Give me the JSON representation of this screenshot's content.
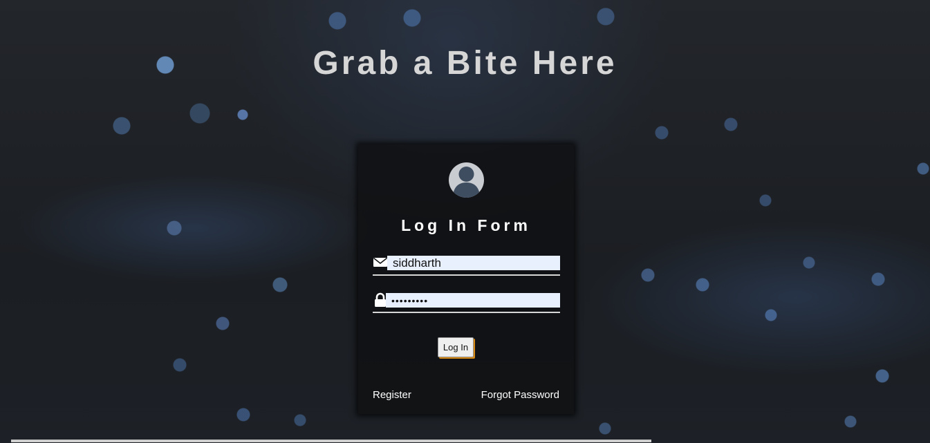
{
  "page": {
    "title": "Grab a Bite Here"
  },
  "login": {
    "avatar_icon": "user-avatar-icon",
    "title": "Log In Form",
    "username_icon": "envelope-icon",
    "username_value": "siddharth",
    "password_icon": "lock-icon",
    "password_value": "•••••••••",
    "submit_label": "Log In",
    "register_label": "Register",
    "forgot_label": "Forgot Password"
  },
  "colors": {
    "background": "#1c1f24",
    "card": "#101113",
    "title_text": "#d6d6d6",
    "input_fill": "#e8f0fe",
    "button_accent": "#d88a14"
  }
}
